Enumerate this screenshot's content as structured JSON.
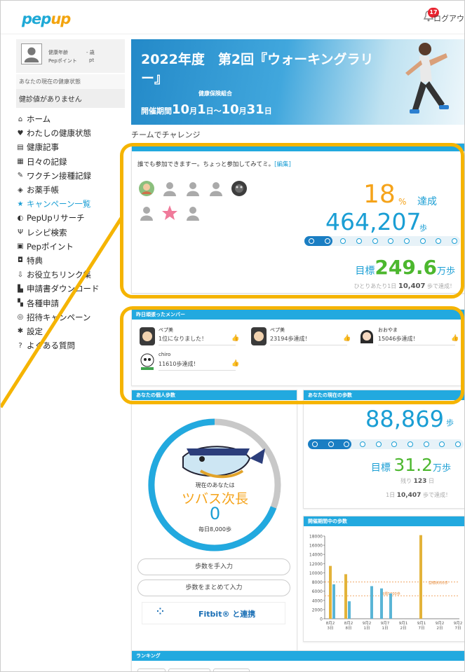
{
  "header": {
    "logo_left": "pep",
    "logo_right": "up",
    "notification_count": "17",
    "logout_label": "ログアウ"
  },
  "sidebar": {
    "profile": {
      "label1": "健康年齢",
      "value1": "- 歳",
      "label2": "Pepポイント",
      "value2": "pt"
    },
    "health_status_label": "あなたの現在の健康状態",
    "health_status_value": "健診値がありません",
    "items": [
      {
        "icon": "home-icon",
        "glyph": "⌂",
        "label": "ホーム"
      },
      {
        "icon": "heart-icon",
        "glyph": "♥",
        "label": "わたしの健康状態"
      },
      {
        "icon": "article-icon",
        "glyph": "▤",
        "label": "健康記事"
      },
      {
        "icon": "calendar-icon",
        "glyph": "▦",
        "label": "日々の記録"
      },
      {
        "icon": "syringe-icon",
        "glyph": "✎",
        "label": "ワクチン接種記録"
      },
      {
        "icon": "pill-icon",
        "glyph": "◈",
        "label": "お薬手帳"
      },
      {
        "icon": "star-icon",
        "glyph": "★",
        "label": "キャンペーン一覧",
        "active": true
      },
      {
        "icon": "pepup-icon",
        "glyph": "◐",
        "label": "PepUpリサーチ"
      },
      {
        "icon": "recipe-icon",
        "glyph": "Ψ",
        "label": "レシピ検索"
      },
      {
        "icon": "points-icon",
        "glyph": "▣",
        "label": "Pepポイント"
      },
      {
        "icon": "gift-icon",
        "glyph": "◘",
        "label": "特典"
      },
      {
        "icon": "link-icon",
        "glyph": "⇩",
        "label": "お役立ちリンク集"
      },
      {
        "icon": "download-icon",
        "glyph": "▙",
        "label": "申請書ダウンロード"
      },
      {
        "icon": "form-icon",
        "glyph": "▚",
        "label": "各種申請"
      },
      {
        "icon": "invite-icon",
        "glyph": "◎",
        "label": "招待キャンペーン"
      },
      {
        "icon": "settings-icon",
        "glyph": "✱",
        "label": "設定"
      },
      {
        "icon": "faq-icon",
        "glyph": "?",
        "label": "よくある質問"
      }
    ]
  },
  "banner": {
    "title": "2022年度　第2回『ウォーキングラリー』",
    "organizer": "健康保険組合",
    "period_prefix": "開催期間",
    "start_month": "10",
    "start_day": "1",
    "end_month": "10",
    "end_day": "31",
    "month_char": "月",
    "day_char": "日",
    "tilde": "～"
  },
  "team": {
    "section_label": "チームでチャレンジ",
    "invite_text": "誰でも参加できますー。ちょっと参加してみてミ。",
    "edit_link": "[編集]",
    "percent": "18",
    "percent_unit": "%",
    "percent_label": "達成",
    "steps": "464,207",
    "steps_unit": "歩",
    "progress": 0.18,
    "goal_label": "目標",
    "goal_value": "249.6",
    "goal_unit": "万歩",
    "per_day_prefix": "ひとりあたり1日",
    "per_day_value": "10,407",
    "per_day_suffix": "歩で達成！"
  },
  "yesterday": {
    "title": "昨日頑張ったメンバー",
    "members": [
      {
        "name": "ペプ美",
        "message": "1位になりました！"
      },
      {
        "name": "ペプ美",
        "message": "23194歩達成！"
      },
      {
        "name": "おおやま",
        "message": "15046歩達成！"
      },
      {
        "name": "chiro",
        "message": "11610歩達成！"
      }
    ],
    "like_glyph": "👍"
  },
  "personal": {
    "title": "あなたの個人歩数",
    "now_label": "現在のあなたは",
    "rank_title": "ツバス次長",
    "steps": "0",
    "daily_label": "毎日8,000歩",
    "manual_button": "歩数を手入力",
    "bulk_button": "歩数をまとめて入力",
    "fitbit_label": "Fitbit® と連携",
    "fitbit_glyph": "⁘"
  },
  "current": {
    "title": "あなたの現在の歩数",
    "steps": "88,869",
    "steps_unit": "歩",
    "progress": 0.28,
    "goal_label": "目標",
    "goal_value": "31.2",
    "goal_unit": "万歩",
    "remain_prefix": "残り",
    "remain_value": "123",
    "remain_suffix": "日",
    "per_day_prefix": "1日",
    "per_day_value": "10,407",
    "per_day_suffix": "歩で達成！"
  },
  "period": {
    "title": "開催期間中の歩数"
  },
  "ranking": {
    "title": "ランキング"
  },
  "colors": {
    "accent_blue": "#1a9ed4",
    "header_blue": "#22a9df",
    "orange": "#f5a31a",
    "green": "#4cb72e",
    "highlight": "#f5b400"
  },
  "chart_data": {
    "type": "bar",
    "categories": [
      "8月2",
      "8月3",
      "8月2",
      "8月6",
      "9月2",
      "9月1",
      "9月7",
      "9月2",
      "9月1",
      "9月7",
      "9月2",
      "9月2"
    ],
    "x_tick_labels": [
      "8月2\n3日",
      "8月2\n8日",
      "9月2\n1日",
      "9月7\n1日",
      "9月1\n2日",
      "9月1\n7日",
      "9月2\n2日",
      "9月2\n7日"
    ],
    "series": [
      {
        "color": "#e3b33a",
        "values": [
          11500,
          9700,
          0,
          0,
          0,
          18200
        ]
      },
      {
        "color": "#5ab5d6",
        "values": [
          7500,
          3800,
          7100,
          6600,
          5500,
          0
        ]
      }
    ],
    "ylim": [
      0,
      18000
    ],
    "yticks": [
      0,
      2000,
      4000,
      6000,
      8000,
      10000,
      12000,
      14000,
      16000,
      18000
    ],
    "reference_lines": [
      {
        "value": 8000,
        "label": "目標8000歩"
      },
      {
        "value": 5000,
        "label": "目標5000歩"
      }
    ]
  }
}
